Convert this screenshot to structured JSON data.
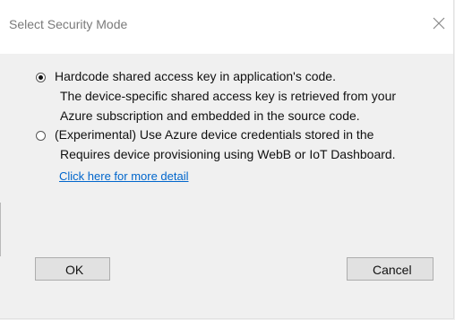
{
  "window": {
    "title": "Select Security Mode"
  },
  "options": [
    {
      "selected": true,
      "label": "Hardcode shared access key in application's code.",
      "description_lines": [
        "The device-specific shared access key is retrieved from your",
        "Azure subscription and embedded in the source code."
      ]
    },
    {
      "selected": false,
      "label": "(Experimental) Use Azure device credentials stored in the",
      "description_lines": [
        "Requires device provisioning using WebB or IoT Dashboard."
      ]
    }
  ],
  "link": {
    "text": "Click here for more detail"
  },
  "buttons": {
    "ok_label": "OK",
    "cancel_label": "Cancel"
  },
  "icons": {
    "close": "close-icon"
  },
  "colors": {
    "link": "#0066cc",
    "title_text": "#7a7a7a",
    "dialog_bg": "#f0f0f0",
    "titlebar_bg": "#ffffff"
  }
}
